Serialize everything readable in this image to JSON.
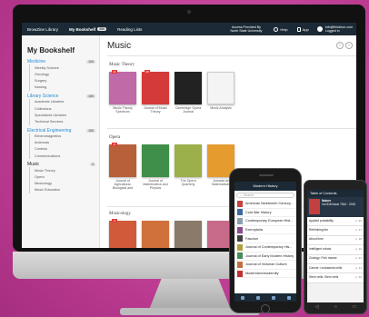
{
  "topbar": {
    "tabs": [
      {
        "label": "BrowZine Library"
      },
      {
        "label": "My Bookshelf",
        "badge": "200"
      },
      {
        "label": "Reading Lists"
      }
    ],
    "provider_line1": "Access Provided By",
    "provider_line2": "North State University",
    "help": "Help",
    "app": "App",
    "account_email": "info@thirdiron.com",
    "account_status": "Logged in"
  },
  "sidebar": {
    "title": "My Bookshelf",
    "categories": [
      {
        "label": "Medicine",
        "count": "100",
        "subs": [
          "Weekly Science",
          "Oncology",
          "Surgery",
          "Nursing"
        ]
      },
      {
        "label": "Library Science",
        "count": "100",
        "subs": [
          "Academic Libraries",
          "Collections",
          "Specialized Libraries",
          "Technical Services"
        ]
      },
      {
        "label": "Electrical Engineering",
        "count": "100",
        "subs": [
          "Electromagnetics",
          "Antennas",
          "Controls",
          "Communications"
        ]
      },
      {
        "label": "Music",
        "count": "4",
        "subs": [
          "Music Theory",
          "Opera",
          "Musicology",
          "Music Education"
        ]
      }
    ]
  },
  "main": {
    "title": "Music",
    "sections": [
      {
        "title": "Music Theory",
        "books": [
          {
            "caption": "Music Theory Spectrum",
            "color": "#c16aa8",
            "flag": "11"
          },
          {
            "caption": "Journal of Music Theory",
            "color": "#d43a3a",
            "flag": "25"
          },
          {
            "caption": "Cambridge Opera Journal",
            "color": "#222222",
            "flag": ""
          },
          {
            "caption": "Music Analysis",
            "color": "#f4f4f4",
            "flag": ""
          }
        ]
      },
      {
        "title": "Opera",
        "books": [
          {
            "caption": "Journal of Agricultural, Biological and",
            "color": "#b8603a",
            "flag": "8"
          },
          {
            "caption": "Journal of Mathematics and Physics",
            "color": "#3f8f4a",
            "flag": ""
          },
          {
            "caption": "The Opera Quarterly",
            "color": "#9bb04a",
            "flag": ""
          },
          {
            "caption": "Jornada de Matemáticas",
            "color": "#e59b2e",
            "flag": ""
          }
        ]
      },
      {
        "title": "Musicology",
        "books": [
          {
            "caption": "",
            "color": "#d05a3a",
            "flag": "4"
          },
          {
            "caption": "",
            "color": "#d0703a",
            "flag": ""
          },
          {
            "caption": "",
            "color": "#8a7a6a",
            "flag": ""
          },
          {
            "caption": "",
            "color": "#c86a8a",
            "flag": ""
          }
        ]
      }
    ]
  },
  "iphone": {
    "header": "Modern History",
    "search_placeholder": "Search",
    "rows": [
      {
        "label": "American Nineteenth Century...",
        "color": "#c84040"
      },
      {
        "label": "Cold War History",
        "color": "#3a6aa0"
      },
      {
        "label": "Contemporary European Hist...",
        "color": "#8aa0b0"
      },
      {
        "label": "Exemplaria",
        "color": "#8a4a8a"
      },
      {
        "label": "Fascism",
        "color": "#404040"
      },
      {
        "label": "Journal of Contemporary His...",
        "color": "#b0a040"
      },
      {
        "label": "Journal of Early Modern History",
        "color": "#4a8a5a"
      },
      {
        "label": "Journal of Victorian Culture",
        "color": "#c07040"
      },
      {
        "label": "Modernism/modernity",
        "color": "#c03030"
      }
    ]
  },
  "android": {
    "header": "Table of Contents",
    "feature_title": "Nature",
    "feature_sub": "Vol 518 Issue 7544 · 2015",
    "rows": [
      {
        "label": "Applied probability",
        "pp": "p. 36"
      },
      {
        "label": "Rethinking the",
        "pp": "p. 37"
      },
      {
        "label": "About time",
        "pp": "p. 38"
      },
      {
        "label": "Intelligent robots",
        "pp": "p. 40"
      },
      {
        "label": "Zoology: Fish mouse",
        "pp": "p. 43"
      },
      {
        "label": "Cancer: Leukaemia cells",
        "pp": "p. 44"
      },
      {
        "label": "Stem cells: Stem cells",
        "pp": "p. 46"
      }
    ]
  }
}
